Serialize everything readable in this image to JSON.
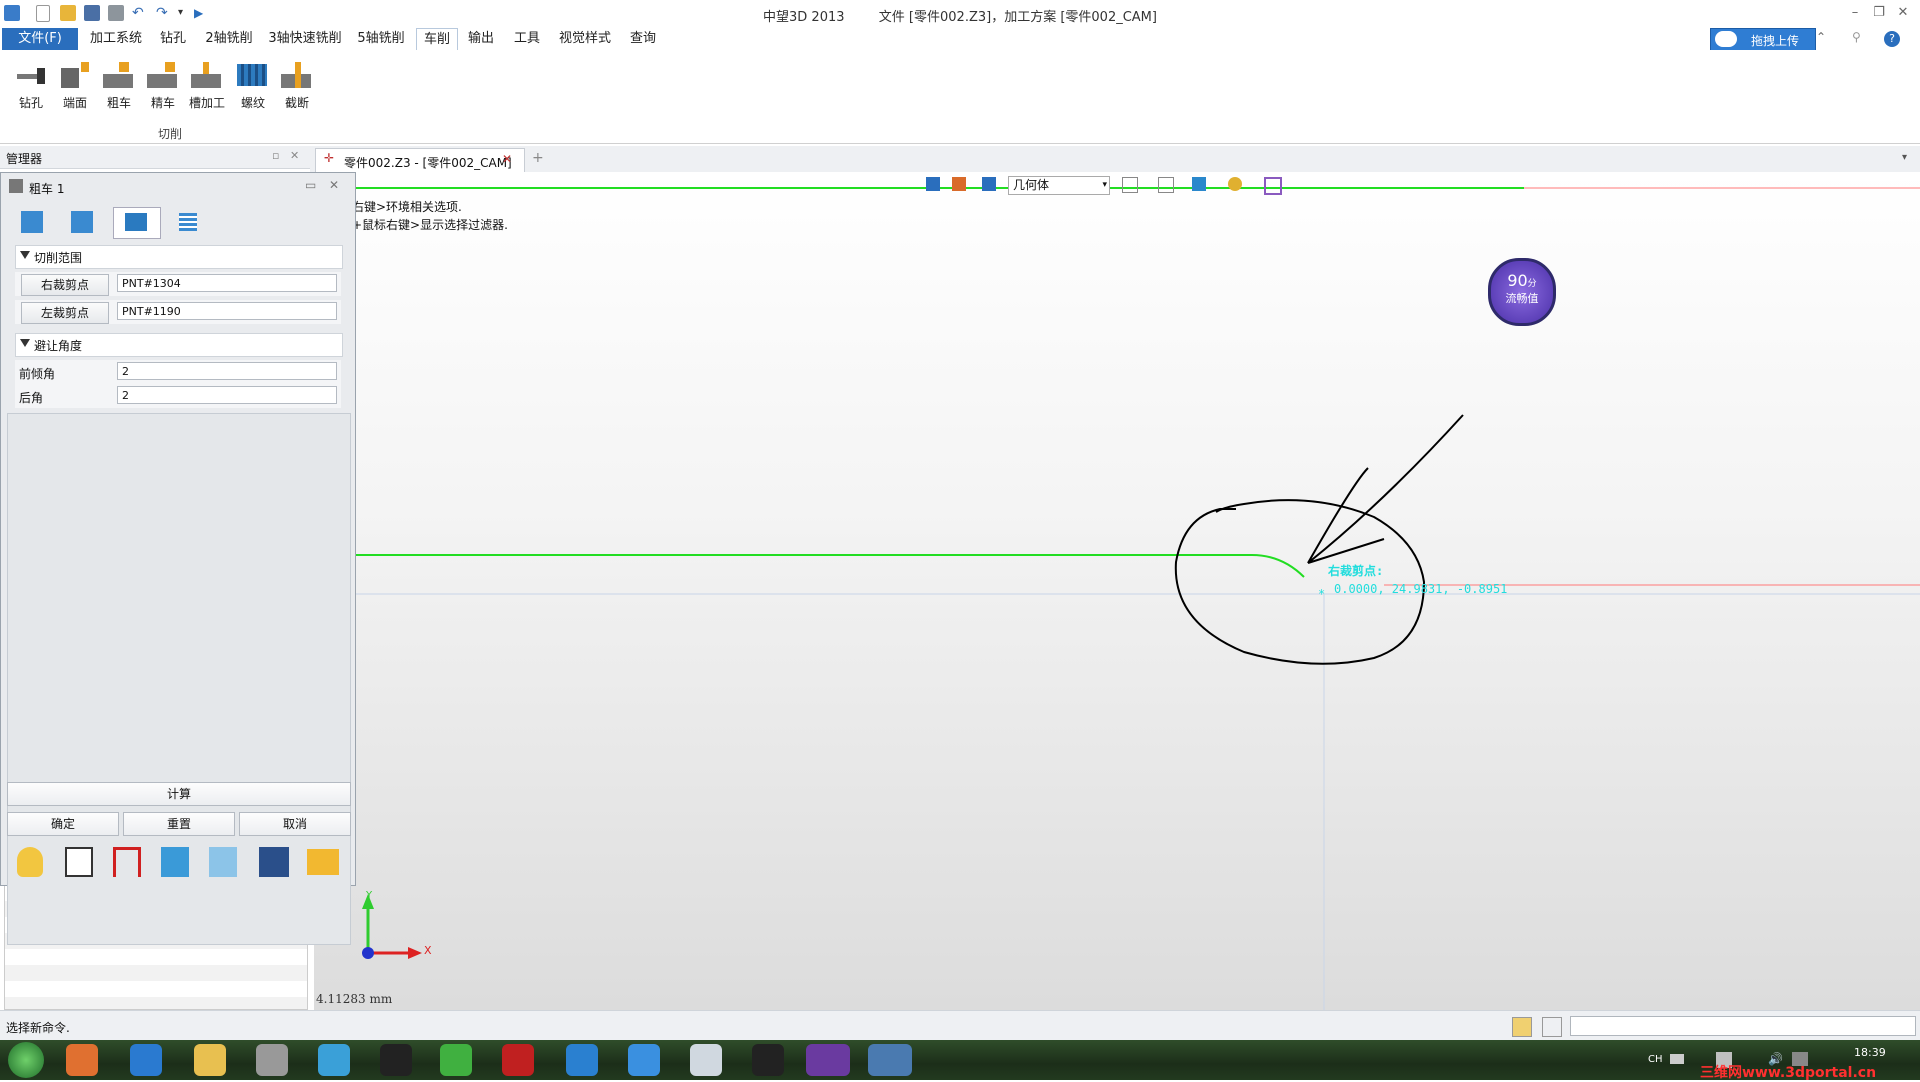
{
  "window": {
    "app_name": "中望3D 2013",
    "doc_title": "文件 [零件002.Z3]，加工方案 [零件002_CAM]"
  },
  "menu": {
    "file": "文件(F)",
    "items": [
      "加工系统",
      "钻孔",
      "2轴铣削",
      "3轴快速铣削",
      "5轴铣削",
      "车削",
      "输出",
      "工具",
      "视觉样式",
      "查询"
    ],
    "active_index": 5
  },
  "top_right": {
    "upload": "拖拽上传"
  },
  "ribbon": {
    "buttons": [
      "钻孔",
      "端面",
      "粗车",
      "精车",
      "槽加工",
      "螺纹",
      "截断"
    ],
    "group_label": "切削"
  },
  "manager": {
    "title": "管理器"
  },
  "doc_tab": {
    "label": "零件002.Z3 - [零件002_CAM]"
  },
  "panel": {
    "title": "粗车 1",
    "section1": "切削范围",
    "right_clip_label": "右裁剪点",
    "right_clip_value": "PNT#1304",
    "left_clip_label": "左裁剪点",
    "left_clip_value": "PNT#1190",
    "section2": "避让角度",
    "front_angle_label": "前倾角",
    "front_angle_value": "2",
    "back_angle_label": "后角",
    "back_angle_value": "2",
    "compute": "计算",
    "ok": "确定",
    "reset": "重置",
    "cancel": "取消"
  },
  "viewport": {
    "hint1": "右键>环境相关选项.",
    "hint2": "+鼠标右键>显示选择过滤器.",
    "filter_value": "几何体",
    "score_value": "90",
    "score_unit": "分",
    "score_label": "流畅值",
    "point_label": "右裁剪点:",
    "point_coords": "0.0000, 24.9831, -0.8951",
    "axis_x": "X",
    "axis_y": "Y",
    "measure": "4.11283 mm"
  },
  "status": {
    "text": "选择新命令."
  },
  "taskbar": {
    "lang": "CH",
    "time": "18:39",
    "watermark": "三维网www.3dportal.cn"
  },
  "colors": {
    "accent": "#2a6ebd",
    "green_line": "#22dd22",
    "red_line": "#ff6666",
    "cyan": "#22dddd"
  }
}
